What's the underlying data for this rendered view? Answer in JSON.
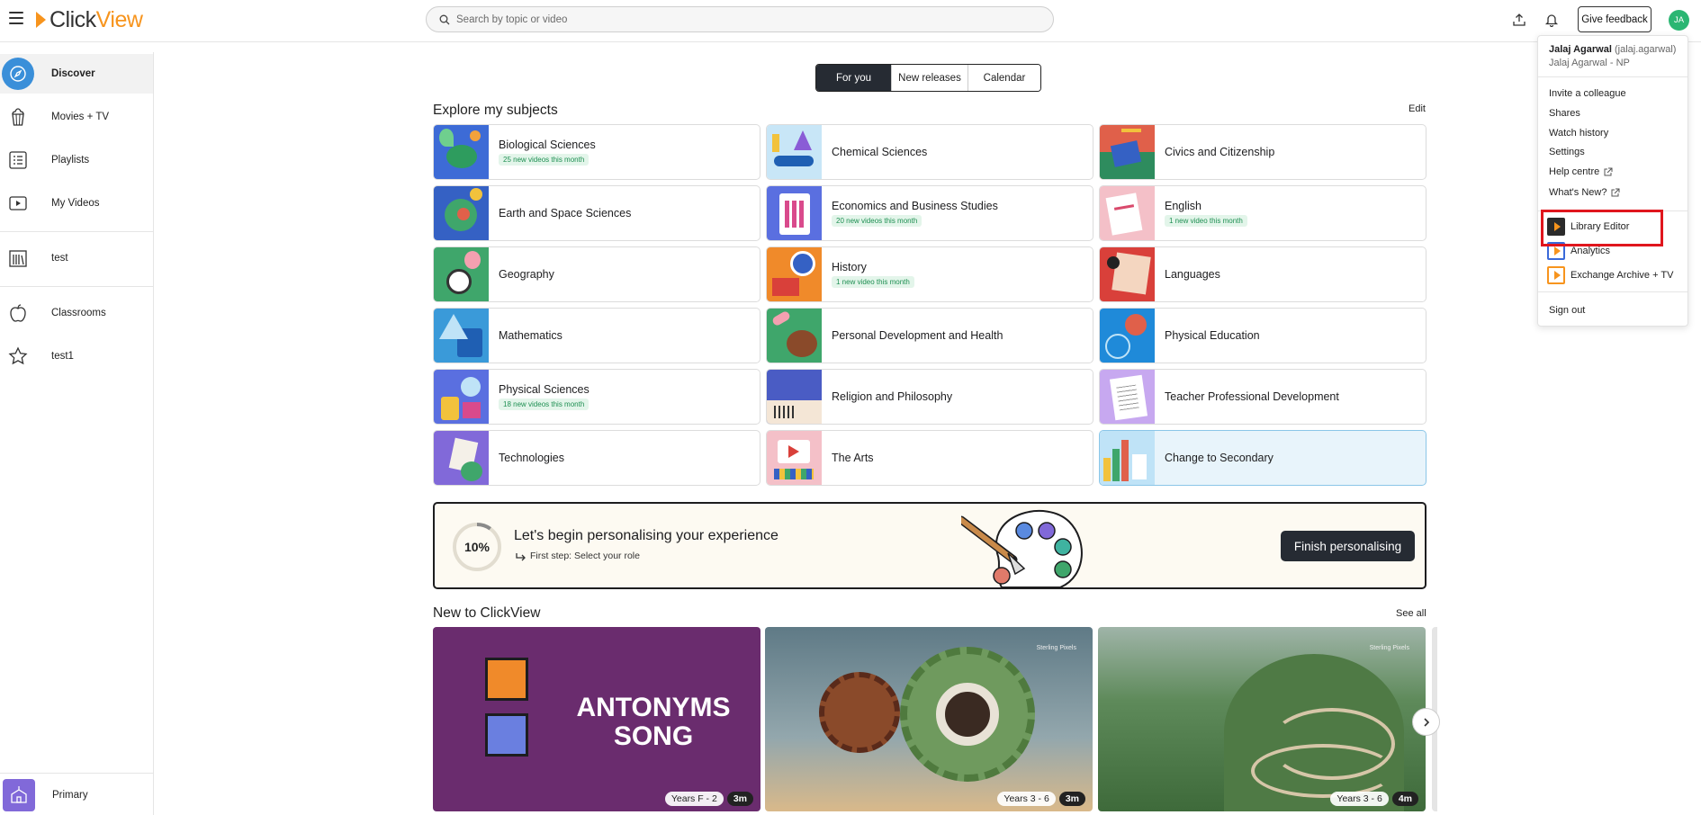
{
  "header": {
    "brand": {
      "prefix": "Click",
      "suffix": "View"
    },
    "search_placeholder": "Search by topic or video",
    "feedback_label": "Give feedback",
    "avatar_initials": "JA",
    "icons": [
      "menu-icon",
      "search-icon",
      "upload-icon",
      "bell-icon"
    ]
  },
  "sidebar": {
    "items": [
      {
        "label": "Discover",
        "icon": "compass-icon",
        "active": true
      },
      {
        "label": "Movies + TV",
        "icon": "popcorn-icon"
      },
      {
        "label": "Playlists",
        "icon": "list-icon"
      },
      {
        "label": "My Videos",
        "icon": "play-icon"
      },
      {
        "label": "test",
        "icon": "library-icon"
      },
      {
        "label": "Classrooms",
        "icon": "apple-icon"
      },
      {
        "label": "test1",
        "icon": "star-icon"
      }
    ],
    "footer_label": "Primary",
    "footer_icon": "school-icon"
  },
  "tabs": [
    "For you",
    "New releases",
    "Calendar"
  ],
  "subjects_section": {
    "title": "Explore my subjects",
    "edit_label": "Edit",
    "items": [
      {
        "name": "Biological Sciences",
        "badge": "25 new videos this month"
      },
      {
        "name": "Chemical Sciences",
        "badge": ""
      },
      {
        "name": "Civics and Citizenship",
        "badge": ""
      },
      {
        "name": "Earth and Space Sciences",
        "badge": ""
      },
      {
        "name": "Economics and Business Studies",
        "badge": "20 new videos this month"
      },
      {
        "name": "English",
        "badge": "1 new video this month"
      },
      {
        "name": "Geography",
        "badge": ""
      },
      {
        "name": "History",
        "badge": "1 new video this month"
      },
      {
        "name": "Languages",
        "badge": ""
      },
      {
        "name": "Mathematics",
        "badge": ""
      },
      {
        "name": "Personal Development and Health",
        "badge": ""
      },
      {
        "name": "Physical Education",
        "badge": ""
      },
      {
        "name": "Physical Sciences",
        "badge": "18 new videos this month"
      },
      {
        "name": "Religion and Philosophy",
        "badge": ""
      },
      {
        "name": "Teacher Professional Development",
        "badge": ""
      },
      {
        "name": "Technologies",
        "badge": ""
      },
      {
        "name": "The Arts",
        "badge": ""
      },
      {
        "name": "Change to Secondary",
        "badge": ""
      }
    ]
  },
  "personalise": {
    "progress_label": "10%",
    "progress_value": 0.1,
    "title": "Let's begin personalising your experience",
    "subtitle": "First step: Select your role",
    "button_label": "Finish personalising"
  },
  "new_section": {
    "title": "New to ClickView",
    "see_all_label": "See all",
    "videos": [
      {
        "title_line1": "ANTONYMS",
        "title_line2": "SONG",
        "years": "Years F - 2",
        "duration": "3m"
      },
      {
        "watermark": "Sterling Pixels",
        "years": "Years 3 - 6",
        "duration": "3m"
      },
      {
        "watermark": "Sterling Pixels",
        "years": "Years 3 - 6",
        "duration": "4m"
      }
    ]
  },
  "user_menu": {
    "name": "Jalaj Agarwal",
    "username": "(jalaj.agarwal)",
    "org": "Jalaj Agarwal - NP",
    "links": [
      "Invite a colleague",
      "Shares",
      "Watch history",
      "Settings",
      "Help centre",
      "What's New?"
    ],
    "apps": [
      "Library Editor",
      "Analytics",
      "Exchange Archive + TV"
    ],
    "sign_out": "Sign out"
  },
  "colors": {
    "brand_orange": "#f7941d",
    "active_blue": "#3a8fd9",
    "dark_button": "#262b33",
    "badge_green": "#1e8f52",
    "highlight_red": "#e0161d"
  }
}
